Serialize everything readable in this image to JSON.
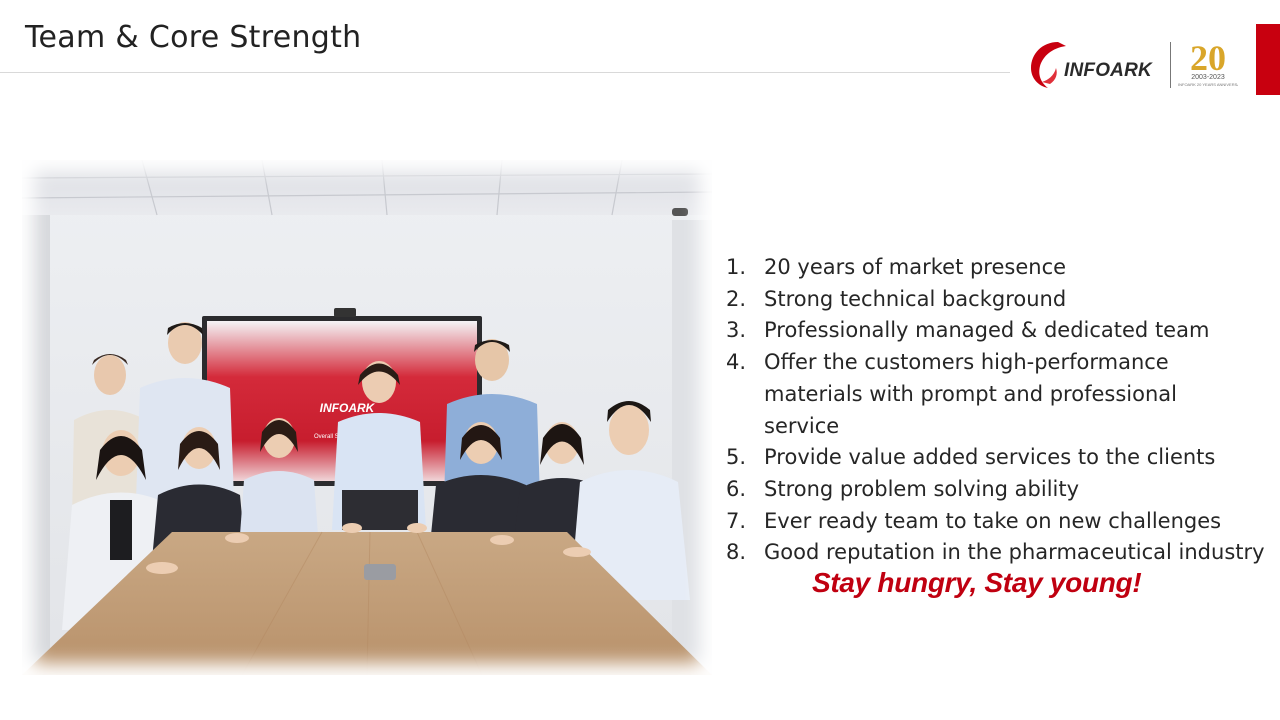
{
  "slide": {
    "title": "Team & Core Strength",
    "accent_color": "#c8000f"
  },
  "logo": {
    "brand": "INFOARK",
    "anniversary_number": "20",
    "anniversary_years": "2003-2023",
    "anniversary_tagline": "INFOARK 20 YEARS ANNIVERSARY"
  },
  "photo": {
    "screen_brand": "INFOARK",
    "screen_caption": "Overall Solution"
  },
  "strengths": [
    {
      "num": "1.",
      "text": "20 years of market presence"
    },
    {
      "num": "2.",
      "text": "Strong technical background"
    },
    {
      "num": "3.",
      "text": "Professionally managed & dedicated team"
    },
    {
      "num": "4.",
      "text": "Offer the customers high-performance materials with prompt and professional service"
    },
    {
      "num": "5.",
      "text": "Provide value added services to the clients"
    },
    {
      "num": "6.",
      "text": "Strong problem solving ability"
    },
    {
      "num": "7.",
      "text": "Ever ready team to take on new challenges"
    },
    {
      "num": "8.",
      "text": "Good reputation in the pharmaceutical industry"
    }
  ],
  "slogan": "Stay hungry, Stay young!"
}
